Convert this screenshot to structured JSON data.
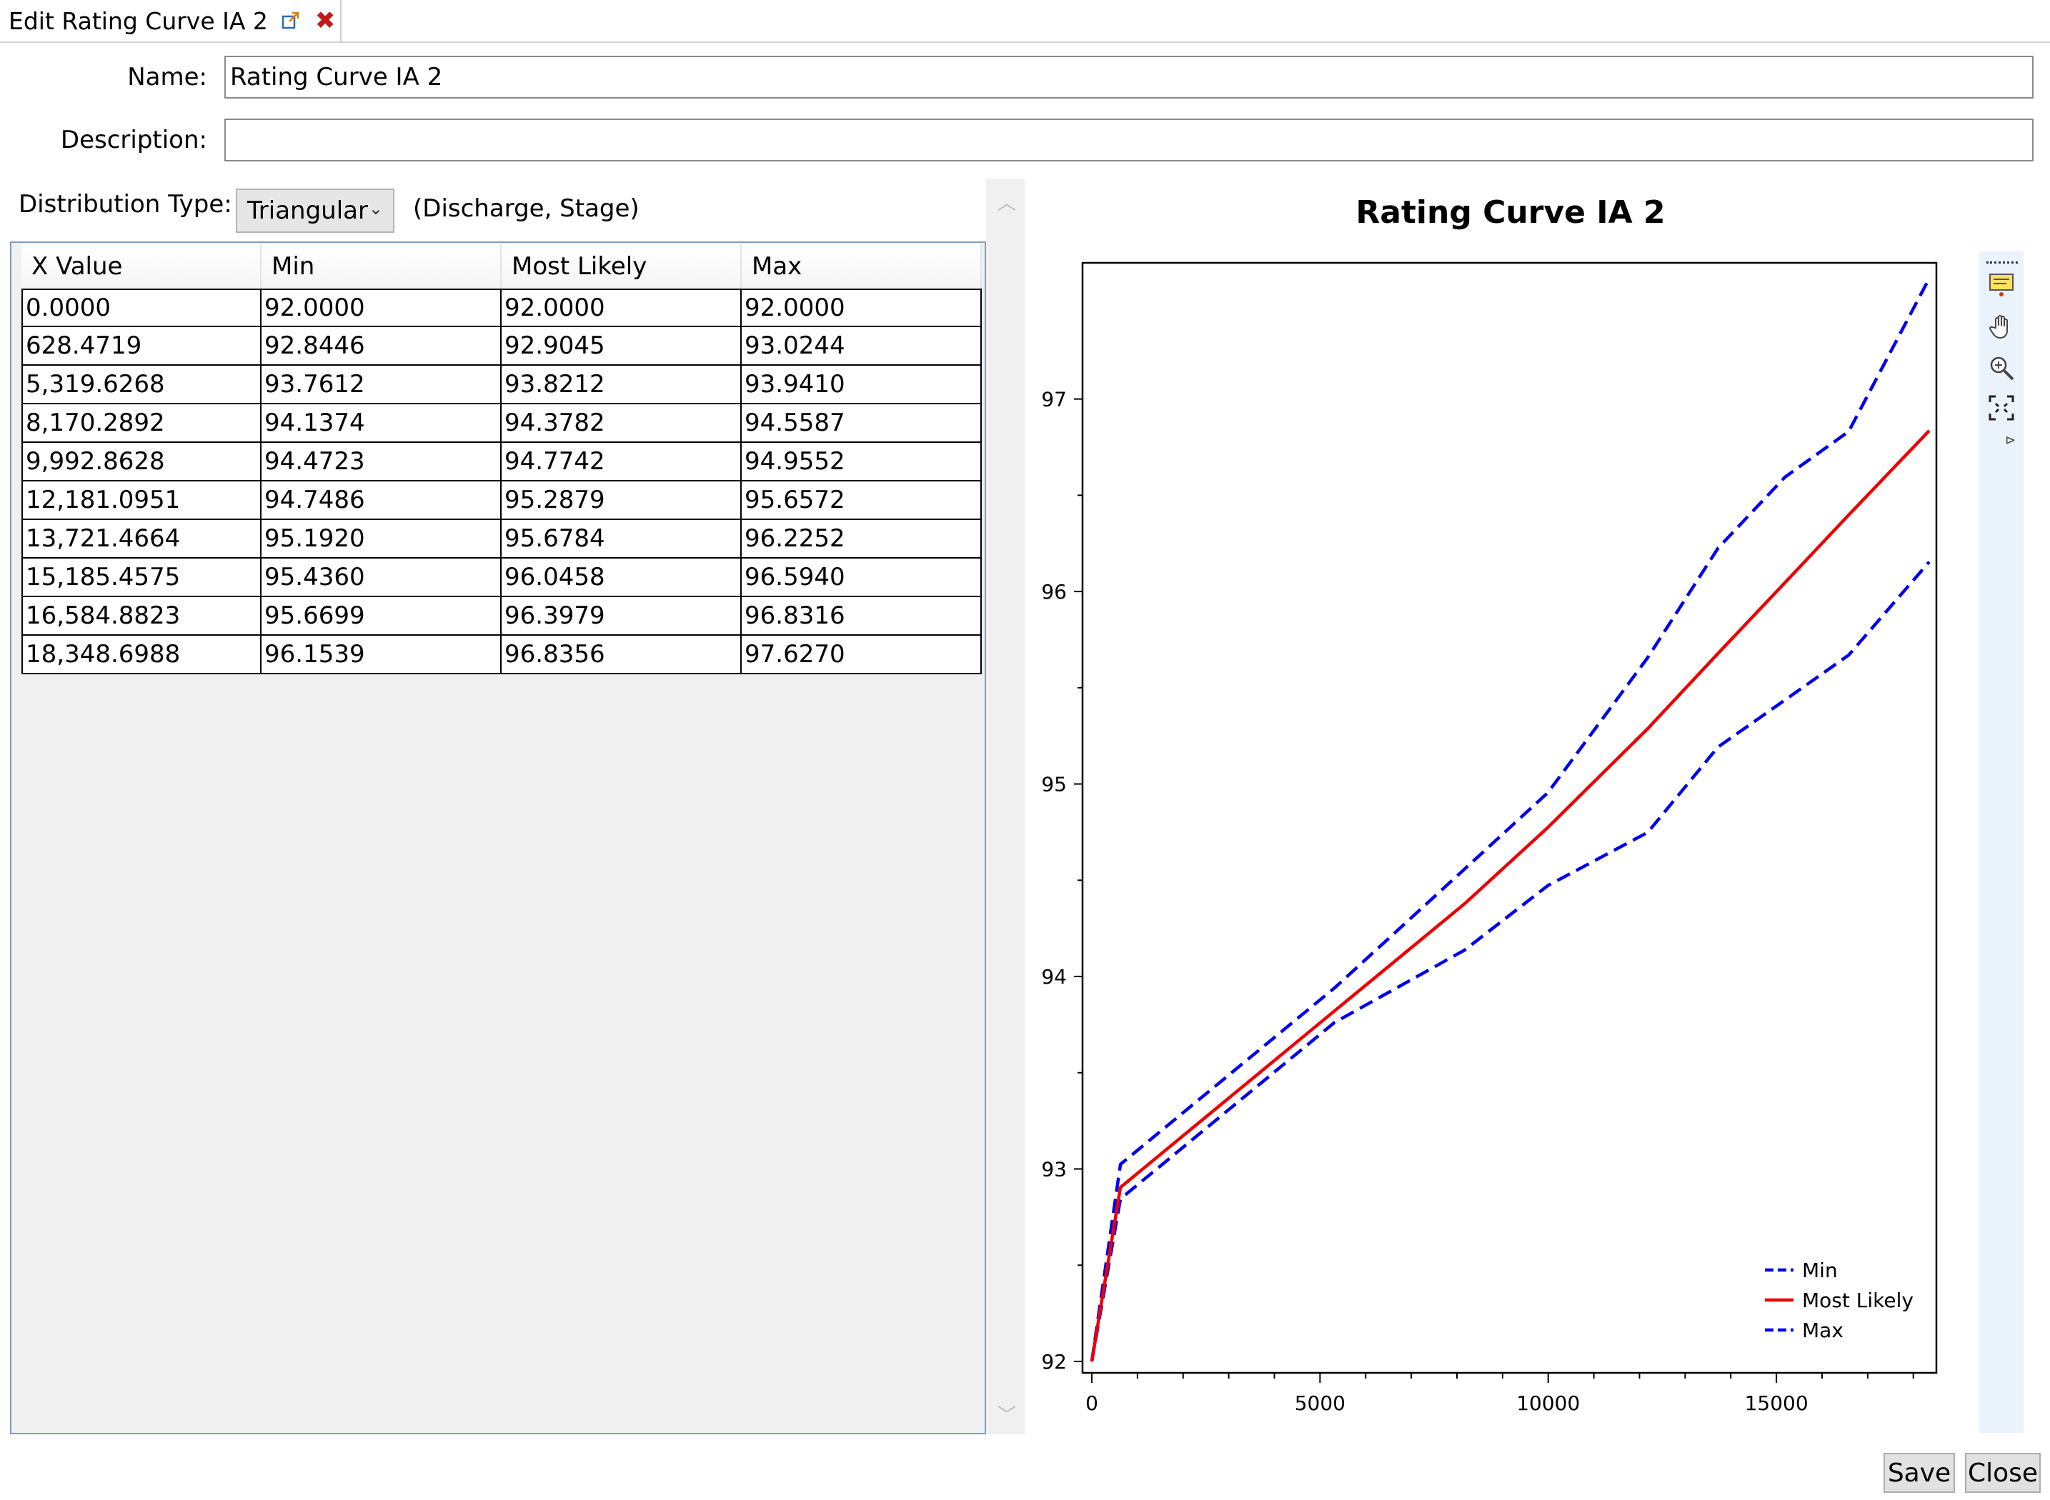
{
  "tab": {
    "title": "Edit Rating Curve IA 2",
    "popout_icon": "popout-icon",
    "close_icon": "close-icon"
  },
  "form": {
    "name_label": "Name:",
    "name_value": "Rating Curve IA 2",
    "description_label": "Description:",
    "description_value": ""
  },
  "distribution": {
    "label": "Distribution Type:",
    "selected": "Triangular",
    "note": "(Discharge, Stage)"
  },
  "table": {
    "columns": [
      "X Value",
      "Min",
      "Most Likely",
      "Max"
    ],
    "rows": [
      [
        "0.0000",
        "92.0000",
        "92.0000",
        "92.0000"
      ],
      [
        "628.4719",
        "92.8446",
        "92.9045",
        "93.0244"
      ],
      [
        "5,319.6268",
        "93.7612",
        "93.8212",
        "93.9410"
      ],
      [
        "8,170.2892",
        "94.1374",
        "94.3782",
        "94.5587"
      ],
      [
        "9,992.8628",
        "94.4723",
        "94.7742",
        "94.9552"
      ],
      [
        "12,181.0951",
        "94.7486",
        "95.2879",
        "95.6572"
      ],
      [
        "13,721.4664",
        "95.1920",
        "95.6784",
        "96.2252"
      ],
      [
        "15,185.4575",
        "95.4360",
        "96.0458",
        "96.5940"
      ],
      [
        "16,584.8823",
        "95.6699",
        "96.3979",
        "96.8316"
      ],
      [
        "18,348.6988",
        "96.1539",
        "96.8356",
        "97.6270"
      ]
    ]
  },
  "chart_data": {
    "type": "line",
    "title": "Rating Curve IA 2",
    "xlabel": "",
    "ylabel": "",
    "x": [
      0,
      628.4719,
      5319.6268,
      8170.2892,
      9992.8628,
      12181.0951,
      13721.4664,
      15185.4575,
      16584.8823,
      18348.6988
    ],
    "series": [
      {
        "name": "Min",
        "color": "#0000ee",
        "dash": true,
        "values": [
          92.0,
          92.8446,
          93.7612,
          94.1374,
          94.4723,
          94.7486,
          95.192,
          95.436,
          95.6699,
          96.1539
        ]
      },
      {
        "name": "Most Likely",
        "color": "#ee0000",
        "dash": false,
        "values": [
          92.0,
          92.9045,
          93.8212,
          94.3782,
          94.7742,
          95.2879,
          95.6784,
          96.0458,
          96.3979,
          96.8356
        ]
      },
      {
        "name": "Max",
        "color": "#0000ee",
        "dash": true,
        "values": [
          92.0,
          93.0244,
          93.941,
          94.5587,
          94.9552,
          95.6572,
          96.2252,
          96.594,
          96.8316,
          97.627
        ]
      }
    ],
    "xlim": [
      0,
      18348.6988
    ],
    "ylim": [
      92,
      97.7
    ],
    "x_ticks": [
      0,
      5000,
      10000,
      15000
    ],
    "y_ticks": [
      92,
      93,
      94,
      95,
      96,
      97
    ],
    "grid": false,
    "legend_position": "bottom-right"
  },
  "toolbar": {
    "icons": [
      "annotation-icon",
      "pan-hand-icon",
      "zoom-icon",
      "zoom-extents-icon"
    ],
    "more_icon": "toolbar-overflow-icon"
  },
  "buttons": {
    "save": "Save",
    "close": "Close"
  }
}
